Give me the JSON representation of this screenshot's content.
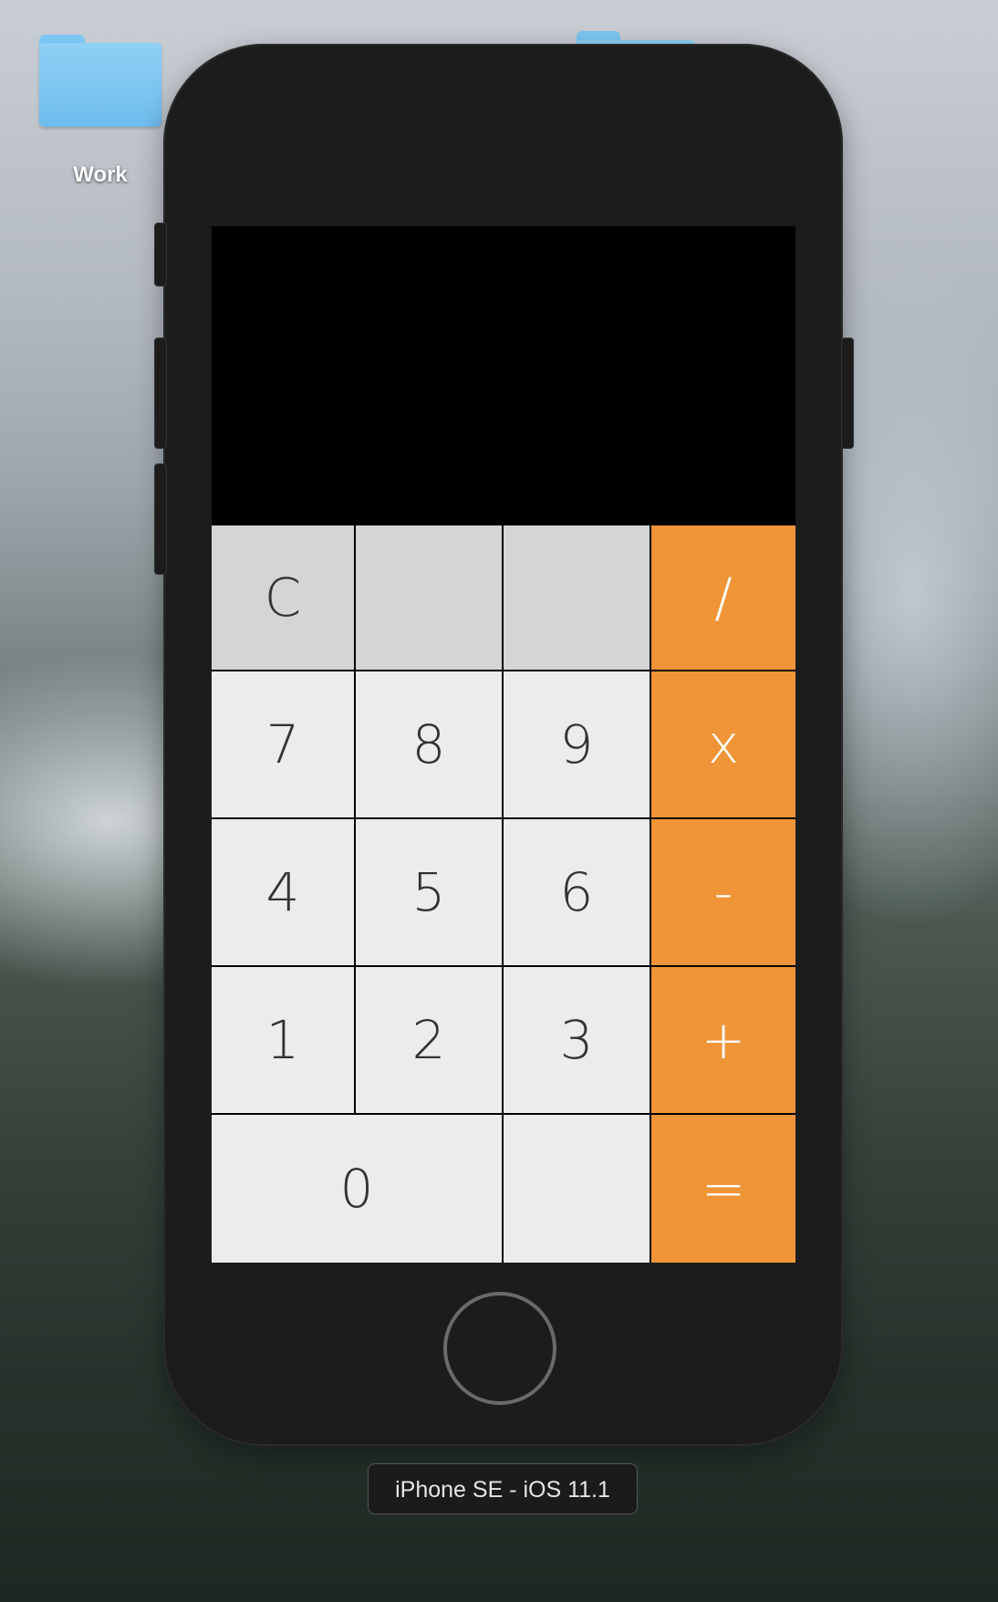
{
  "desktop": {
    "folder_label": "Work"
  },
  "simulator": {
    "device_label": "iPhone SE - iOS 11.1"
  },
  "calculator": {
    "display_value": "",
    "keys": {
      "clear": "C",
      "blank1": "",
      "blank2": "",
      "divide": "/",
      "seven": "7",
      "eight": "8",
      "nine": "9",
      "multiply": "x",
      "four": "4",
      "five": "5",
      "six": "6",
      "subtract": "-",
      "one": "1",
      "two": "2",
      "three": "3",
      "add": "+",
      "zero": "0",
      "decimal": "",
      "equals": "="
    },
    "colors": {
      "operator": "#f09537",
      "function": "#d5d5d5",
      "digit": "#ececec",
      "display": "#000000"
    }
  }
}
